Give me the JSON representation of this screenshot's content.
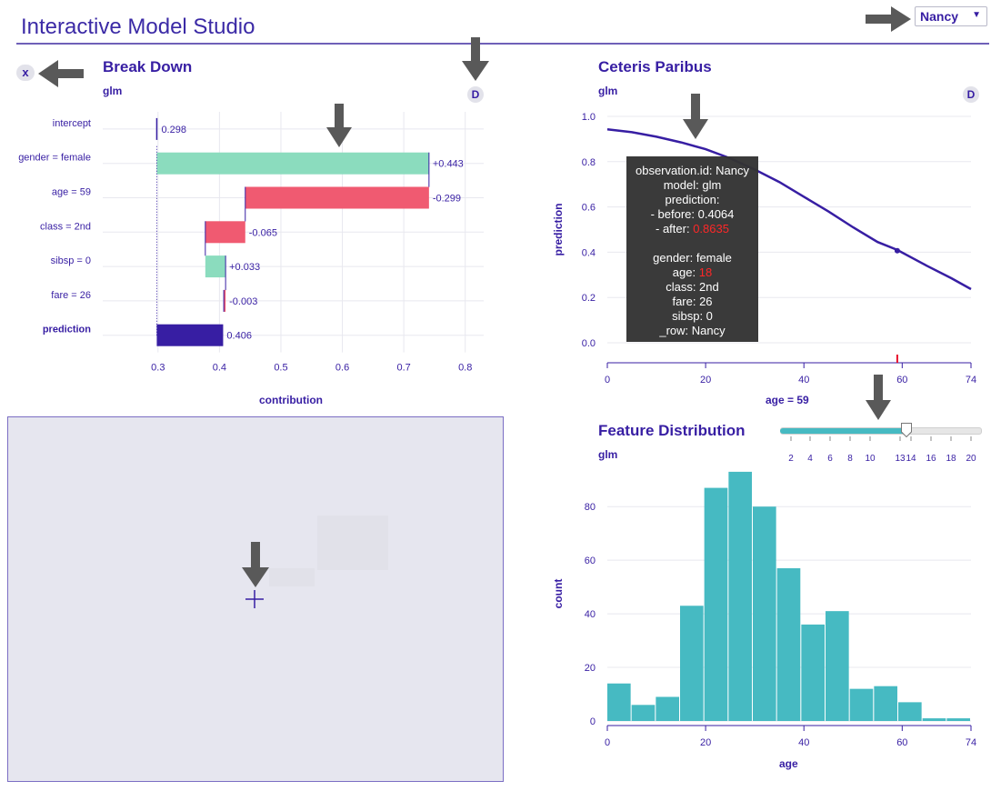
{
  "app": {
    "title": "Interactive Model Studio",
    "observation": "Nancy"
  },
  "arrows": {
    "color": "#595959"
  },
  "breakdown": {
    "title": "Break Down",
    "model": "glm",
    "button": "D",
    "close": "x",
    "xlabel": "contribution",
    "colors": {
      "positive": "#8bdcbe",
      "negative": "#f05a71",
      "prediction": "#371ea3"
    }
  },
  "ceteris": {
    "title": "Ceteris Paribus",
    "model": "glm",
    "button": "D",
    "ylabel": "prediction",
    "xlabel": "age = 59",
    "tooltip": {
      "line1": "observation.id: Nancy",
      "line2": "model: glm",
      "line3": "prediction:",
      "line4": "- before: 0.4064",
      "line5a": "- after: ",
      "line5b": "0.8635",
      "line6": "gender: female",
      "line7a": "age: ",
      "line7b": "18",
      "line8": "class: 2nd",
      "line9": "fare: 26",
      "line10": "sibsp: 0",
      "line11": "_row: Nancy"
    }
  },
  "distribution": {
    "title": "Feature Distribution",
    "model": "glm",
    "xlabel": "age",
    "ylabel": "count",
    "slider": {
      "ticks": [
        "2",
        "4",
        "6",
        "8",
        "10",
        "13",
        "14",
        "16",
        "18",
        "20"
      ],
      "value": 13,
      "min": 1,
      "max": 20
    }
  },
  "chart_data": [
    {
      "type": "bar",
      "title": "Break Down",
      "subtitle": "glm",
      "xlabel": "contribution",
      "xlim": [
        0.25,
        0.83
      ],
      "xticks": [
        0.3,
        0.4,
        0.5,
        0.6,
        0.7,
        0.8
      ],
      "xtick_labels": [
        "0.3",
        "0.4",
        "0.5",
        "0.6",
        "0.7",
        "0.8"
      ],
      "rows": [
        {
          "label": "intercept",
          "start": 0,
          "end": 0.298,
          "value_label": "0.298",
          "kind": "intercept"
        },
        {
          "label": "gender = female",
          "start": 0.298,
          "end": 0.741,
          "value_label": "+0.443",
          "kind": "positive"
        },
        {
          "label": "age = 59",
          "start": 0.741,
          "end": 0.442,
          "value_label": "-0.299",
          "kind": "negative"
        },
        {
          "label": "class = 2nd",
          "start": 0.442,
          "end": 0.377,
          "value_label": "-0.065",
          "kind": "negative"
        },
        {
          "label": "sibsp = 0",
          "start": 0.377,
          "end": 0.41,
          "value_label": "+0.033",
          "kind": "positive"
        },
        {
          "label": "fare = 26",
          "start": 0.41,
          "end": 0.407,
          "value_label": "-0.003",
          "kind": "negative"
        },
        {
          "label": "prediction",
          "start": 0.298,
          "end": 0.406,
          "value_label": "0.406",
          "kind": "prediction"
        }
      ]
    },
    {
      "type": "line",
      "title": "Ceteris Paribus",
      "subtitle": "glm",
      "xlabel": "age = 59",
      "ylabel": "prediction",
      "xlim": [
        0,
        74
      ],
      "ylim": [
        0,
        1
      ],
      "xticks": [
        0,
        20,
        40,
        60,
        74
      ],
      "yticks": [
        0.0,
        0.2,
        0.4,
        0.6,
        0.8,
        1.0
      ],
      "ytick_labels": [
        "0.0",
        "0.2",
        "0.4",
        "0.6",
        "0.8",
        "1.0"
      ],
      "series": [
        {
          "color": "#371ea3",
          "x": [
            0,
            5,
            10,
            15,
            20,
            25,
            30,
            35,
            40,
            45,
            50,
            55,
            59,
            65,
            70,
            74
          ],
          "y": [
            0.943,
            0.93,
            0.91,
            0.885,
            0.855,
            0.815,
            0.765,
            0.71,
            0.645,
            0.58,
            0.51,
            0.445,
            0.41,
            0.34,
            0.285,
            0.237
          ]
        }
      ],
      "observation": {
        "x": 59,
        "y": 0.4064
      },
      "hover": {
        "x": 18,
        "y": 0.8635
      }
    },
    {
      "type": "bar",
      "title": "Feature Distribution",
      "subtitle": "glm",
      "xlabel": "age",
      "ylabel": "count",
      "xlim": [
        0,
        74
      ],
      "ylim": [
        0,
        95
      ],
      "xticks": [
        0,
        20,
        40,
        60,
        74
      ],
      "yticks": [
        0,
        20,
        40,
        60,
        80
      ],
      "bin_width": 4.93,
      "bins": [
        {
          "x0": 0,
          "count": 14
        },
        {
          "x0": 4.93,
          "count": 6
        },
        {
          "x0": 9.87,
          "count": 9
        },
        {
          "x0": 14.8,
          "count": 43
        },
        {
          "x0": 19.73,
          "count": 87
        },
        {
          "x0": 24.67,
          "count": 93
        },
        {
          "x0": 29.6,
          "count": 80
        },
        {
          "x0": 34.53,
          "count": 57
        },
        {
          "x0": 39.47,
          "count": 36
        },
        {
          "x0": 44.4,
          "count": 41
        },
        {
          "x0": 49.33,
          "count": 12
        },
        {
          "x0": 54.27,
          "count": 13
        },
        {
          "x0": 59.2,
          "count": 7
        },
        {
          "x0": 64.13,
          "count": 1
        },
        {
          "x0": 69.07,
          "count": 1
        }
      ],
      "color": "#46bac2"
    }
  ]
}
